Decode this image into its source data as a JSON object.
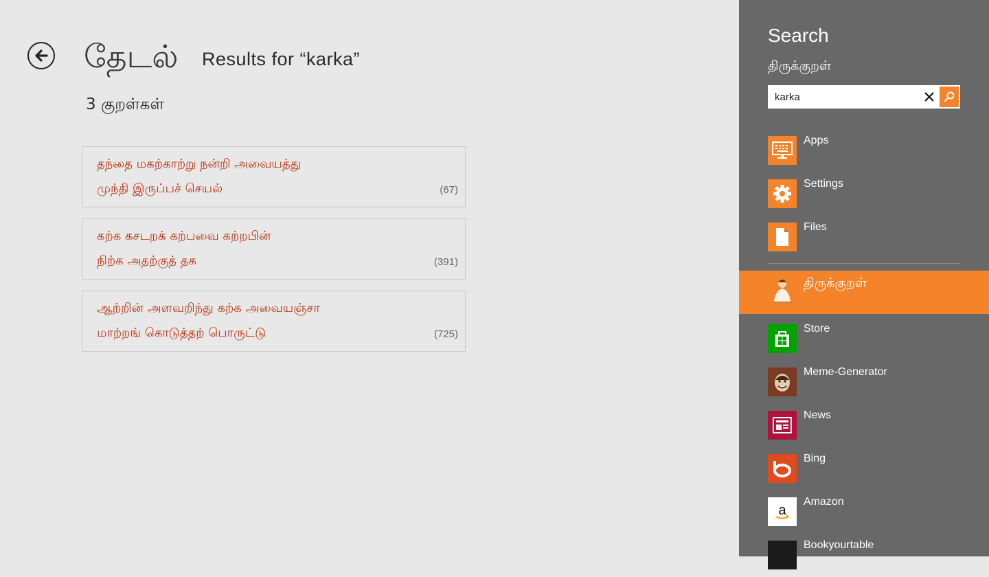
{
  "app": {
    "title": "தேடல்",
    "subtitle": "Results for “karka”",
    "count_label": "3 குறள்கள்",
    "results": [
      {
        "line1": "தந்தை மகற்காற்று நன்றி அவையத்து",
        "line2": "முந்தி இருப்பச் செயல்",
        "number": "(67)"
      },
      {
        "line1": "கற்க கசடறக் கற்பவை கற்றபின்",
        "line2": "நிற்க அதற்குத் தக",
        "number": "(391)"
      },
      {
        "line1": "ஆற்றின் அளவறிந்து கற்க அவையஞ்சா",
        "line2": "மாற்றங் கொடுத்தற் பொருட்டு",
        "number": "(725)"
      }
    ]
  },
  "charm": {
    "title": "Search",
    "scope": "திருக்குறள்",
    "query": "karka",
    "system_items": [
      {
        "label": "Apps",
        "icon": "apps-icon"
      },
      {
        "label": "Settings",
        "icon": "gear-icon"
      },
      {
        "label": "Files",
        "icon": "file-icon"
      }
    ],
    "app_items": [
      {
        "label": "திருக்குறள்",
        "icon": "thirukkural-app-icon",
        "selected": true
      },
      {
        "label": "Store",
        "icon": "store-icon"
      },
      {
        "label": "Meme-Generator",
        "icon": "meme-generator-icon"
      },
      {
        "label": "News",
        "icon": "news-icon"
      },
      {
        "label": "Bing",
        "icon": "bing-icon"
      },
      {
        "label": "Amazon",
        "icon": "amazon-icon"
      },
      {
        "label": "Bookyourtable",
        "icon": "bookyourtable-icon"
      }
    ],
    "colors": {
      "accent": "#f5832a",
      "panel": "#686868",
      "kural_text": "#b8330f"
    }
  }
}
